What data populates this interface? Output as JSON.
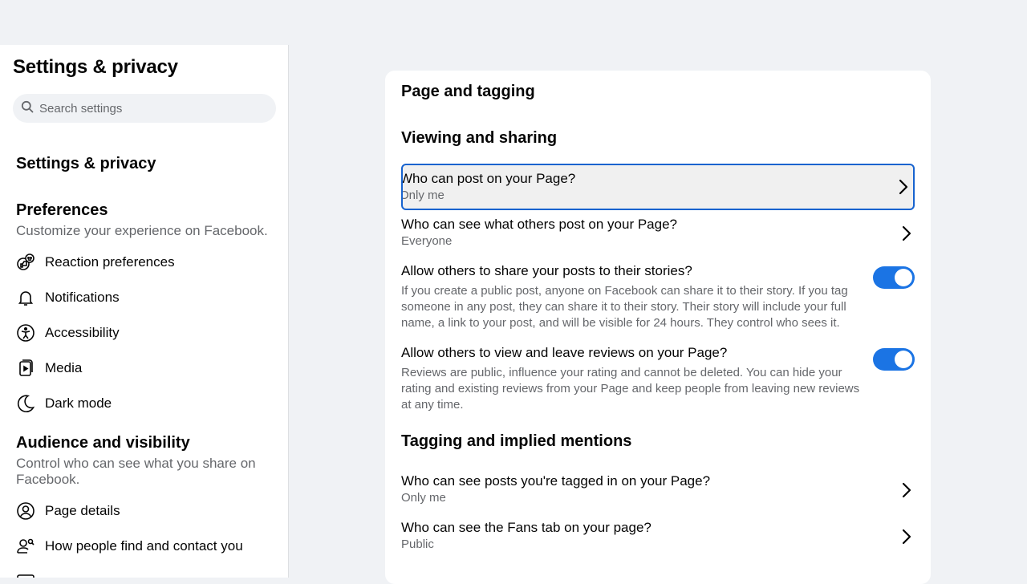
{
  "sidebar": {
    "title": "Settings & privacy",
    "search_placeholder": "Search settings",
    "section_main": "Settings & privacy",
    "preferences": {
      "title": "Preferences",
      "subtitle": "Customize your experience on Facebook.",
      "items": [
        {
          "label": "Reaction preferences",
          "icon": "reaction-icon"
        },
        {
          "label": "Notifications",
          "icon": "bell-icon"
        },
        {
          "label": "Accessibility",
          "icon": "accessibility-icon"
        },
        {
          "label": "Media",
          "icon": "media-icon"
        },
        {
          "label": "Dark mode",
          "icon": "moon-icon"
        }
      ]
    },
    "audience": {
      "title": "Audience and visibility",
      "subtitle": "Control who can see what you share on Facebook.",
      "items": [
        {
          "label": "Page details",
          "icon": "user-circle-icon"
        },
        {
          "label": "How people find and contact you",
          "icon": "people-search-icon"
        }
      ]
    }
  },
  "main": {
    "title": "Page and tagging",
    "viewing": {
      "title": "Viewing and sharing",
      "rows": [
        {
          "label": "Who can post on your Page?",
          "value": "Only me"
        },
        {
          "label": "Who can see what others post on your Page?",
          "value": "Everyone"
        }
      ],
      "toggles": [
        {
          "label": "Allow others to share your posts to their stories?",
          "description": "If you create a public post, anyone on Facebook can share it to their story. If you tag someone in any post, they can share it to their story. Their story will include your full name, a link to your post, and will be visible for 24 hours. They control who sees it.",
          "on": true
        },
        {
          "label": "Allow others to view and leave reviews on your Page?",
          "description": "Reviews are public, influence your rating and cannot be deleted. You can hide your rating and existing reviews from your Page and keep people from leaving new reviews at any time.",
          "on": true
        }
      ]
    },
    "tagging": {
      "title": "Tagging and implied mentions",
      "rows": [
        {
          "label": "Who can see posts you're tagged in on your Page?",
          "value": "Only me"
        },
        {
          "label": "Who can see the Fans tab on your page?",
          "value": "Public"
        }
      ]
    }
  },
  "colors": {
    "accent": "#1b74e4",
    "focus": "#1763cf"
  }
}
